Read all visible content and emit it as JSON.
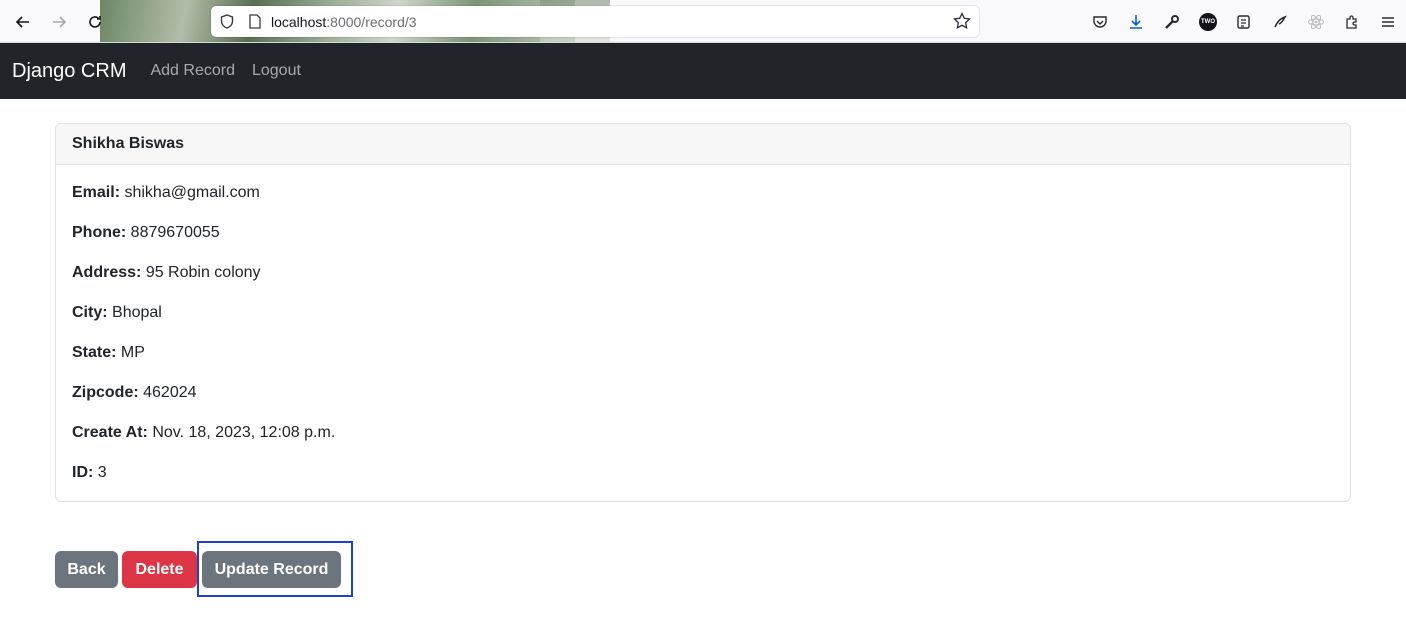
{
  "browser": {
    "url_host": "localhost",
    "url_path": ":8000/record/3"
  },
  "navbar": {
    "brand": "Django CRM",
    "links": [
      "Add Record",
      "Logout"
    ]
  },
  "record": {
    "name": "Shikha Biswas",
    "fields": [
      {
        "label": "Email:",
        "value": "shikha@gmail.com"
      },
      {
        "label": "Phone:",
        "value": "8879670055"
      },
      {
        "label": "Address:",
        "value": "95 Robin colony"
      },
      {
        "label": "City:",
        "value": "Bhopal"
      },
      {
        "label": "State:",
        "value": "MP"
      },
      {
        "label": "Zipcode:",
        "value": "462024"
      },
      {
        "label": "Create At:",
        "value": "Nov. 18, 2023, 12:08 p.m."
      },
      {
        "label": "ID:",
        "value": "3"
      }
    ]
  },
  "actions": {
    "back": "Back",
    "delete": "Delete",
    "update": "Update Record"
  },
  "colors": {
    "navbar_bg": "#212529",
    "secondary": "#6c757d",
    "danger": "#dc3545",
    "focus": "#1f3fd1"
  },
  "icons": {
    "back": "arrow-left-icon",
    "forward": "arrow-right-icon",
    "reload": "reload-icon",
    "shield": "shield-icon",
    "page": "page-icon",
    "bookmark": "star-icon"
  }
}
